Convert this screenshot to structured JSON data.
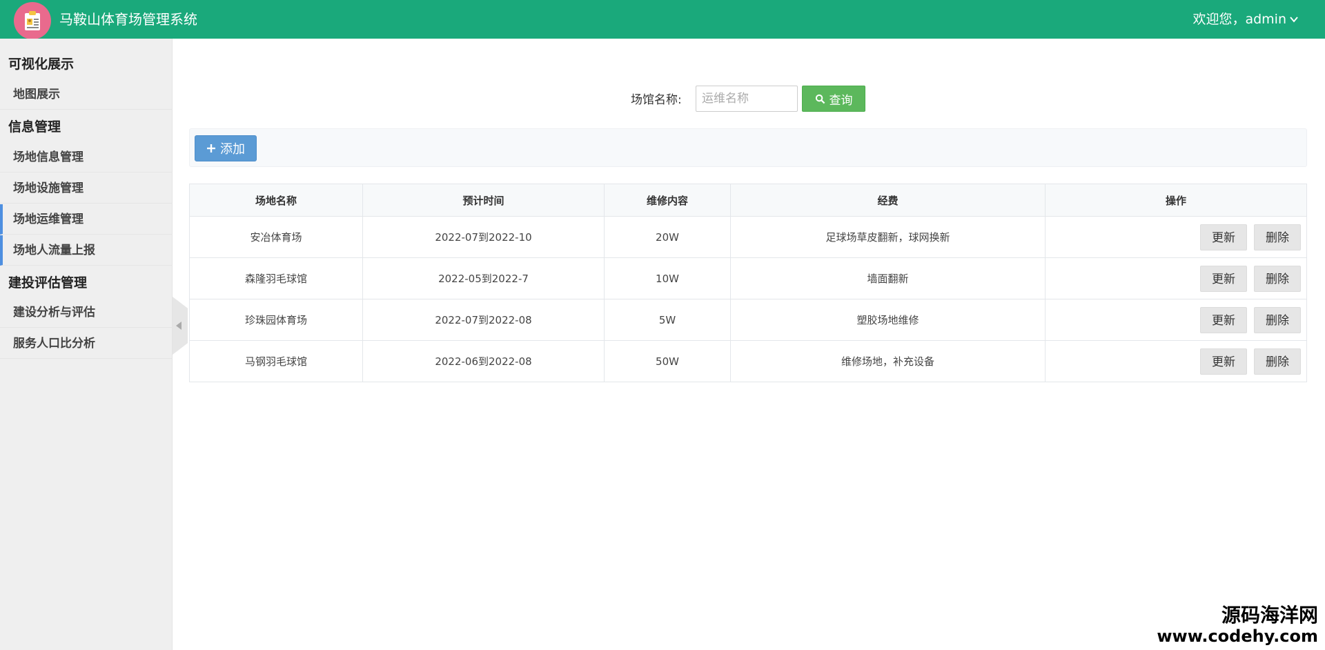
{
  "header": {
    "title": "马鞍山体育场管理系统",
    "welcome": "欢迎您，admin"
  },
  "sidebar": {
    "groups": [
      {
        "title": "可视化展示",
        "items": [
          {
            "label": "地图展示"
          }
        ]
      },
      {
        "title": "信息管理",
        "items": [
          {
            "label": "场地信息管理"
          },
          {
            "label": "场地设施管理"
          },
          {
            "label": "场地运维管理"
          },
          {
            "label": "场地人流量上报"
          }
        ]
      },
      {
        "title": "建投评估管理",
        "items": [
          {
            "label": "建设分析与评估"
          },
          {
            "label": "服务人口比分析"
          }
        ]
      }
    ]
  },
  "search": {
    "label": "场馆名称:",
    "placeholder": "运维名称",
    "button_label": "查询"
  },
  "toolbar": {
    "add_label": "添加"
  },
  "table": {
    "columns": [
      "场地名称",
      "预计时间",
      "维修内容",
      "经费",
      "操作"
    ],
    "rows": [
      {
        "name": "安冶体育场",
        "time": "2022-07到2022-10",
        "content": "20W",
        "fee": "足球场草皮翻新，球网换新"
      },
      {
        "name": "森隆羽毛球馆",
        "time": "2022-05到2022-7",
        "content": "10W",
        "fee": "墙面翻新"
      },
      {
        "name": "珍珠园体育场",
        "time": "2022-07到2022-08",
        "content": "5W",
        "fee": "塑胶场地维修"
      },
      {
        "name": "马钢羽毛球馆",
        "time": "2022-06到2022-08",
        "content": "50W",
        "fee": "维修场地，补充设备"
      }
    ],
    "update_label": "更新",
    "delete_label": "删除"
  },
  "watermark": {
    "name": "源码海洋网",
    "url": "www.codehy.com"
  },
  "colors": {
    "header_bg": "#1aa97b",
    "search_button": "#5cb85c",
    "add_button": "#5b9bd5",
    "active_indicator": "#4e8fe0"
  },
  "icons": {
    "logo": "clipboard-id-icon",
    "user_dropdown": "chevron-down-icon",
    "search": "search-icon",
    "add": "plus-icon",
    "collapse": "chevron-left-icon"
  }
}
